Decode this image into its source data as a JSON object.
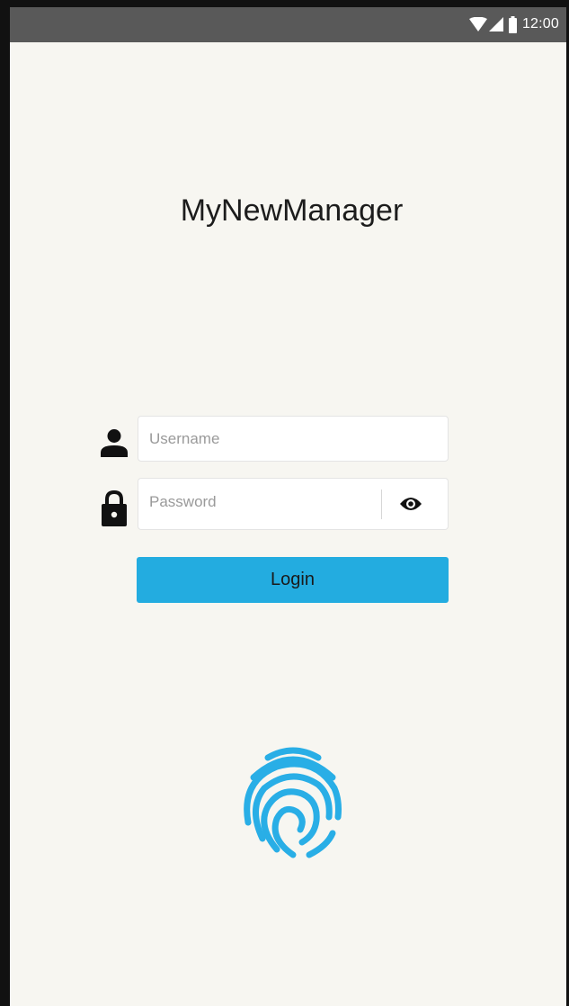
{
  "status_bar": {
    "time": "12:00",
    "icons": [
      "wifi-icon",
      "signal-icon",
      "battery-icon"
    ]
  },
  "app": {
    "title": "MyNewManager"
  },
  "login_form": {
    "username": {
      "placeholder": "Username",
      "value": "",
      "icon": "person-icon"
    },
    "password": {
      "placeholder": "Password",
      "value": "",
      "icon": "lock-icon",
      "toggle_icon": "eye-icon"
    },
    "login_label": "Login"
  },
  "biometric": {
    "icon": "fingerprint-icon"
  },
  "colors": {
    "background": "#f7f6f1",
    "status_bar": "#595959",
    "accent": "#23ace0",
    "fingerprint": "#29aee6"
  }
}
